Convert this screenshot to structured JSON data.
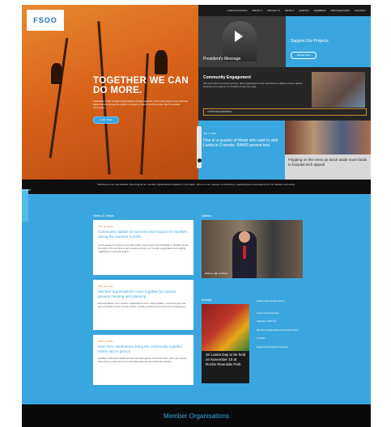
{
  "brand": {
    "logo_text": "FSOO"
  },
  "nav": {
    "items": [
      "CONSULTATIONS",
      "ABOUT ▾",
      "PROJECTS",
      "NEWS ▾",
      "EVENTS",
      "MEMBERS",
      "PARTNERSHIPS",
      "CONTACT"
    ]
  },
  "hero": {
    "title": "TOGETHER WE CAN DO MORE.",
    "text": "Federation of Sri Lankan Organisations brings together community groups and voluntary organisations across the region to support, connect and empower the Sri Lankan community.",
    "button": "Learn More"
  },
  "video": {
    "caption": "President's Message"
  },
  "support": {
    "title": "Support Our Projects",
    "button": "Donate Now"
  },
  "engagement": {
    "title": "Community Engagement",
    "text": "We work with community groups, faith organisations and volunteers to deliver events, advice sessions and support for families across the area.",
    "button": "CONTINUE READING"
  },
  "news_feature": {
    "date": "JUL 7, 2021",
    "text": "One in a quarter of those who said to visit Lanka in 2 weeks. RAMS person test"
  },
  "fundraise": {
    "text": "Flopping on the menu as lunch aside more funds to hospital tech appeal"
  },
  "strip": {
    "text": "Welcome to our new website. We bring all our member organisations together in one place. Join us in our mission of connecting, supporting and empowering our Sri Lankan community."
  },
  "left_tab": {
    "label": "FOLLOW"
  },
  "news": {
    "label": "News & Views",
    "cards": [
      {
        "date": "JUN 16, 2021",
        "title": "Community update on services and support for families during the summer months",
        "body": "Local volunteers continue to provide advice, food support and friendship to families across the region. Find out how to get involved and how our member organisations are helping neighbours in need this season."
      },
      {
        "date": "MAY 28, 2021",
        "title": "Member organisations come together for annual general meeting and planning",
        "body": "Representatives from member organisations met to share updates, review the year and agree priorities for the coming months, including cultural events and youth programmes."
      },
      {
        "date": "APR 14, 2021",
        "title": "New Year celebrations bring the community together online and in person",
        "body": "Families marked the traditional New Year with games, food and music, with many events held online so that everyone could safely take part and celebrate together."
      }
    ]
  },
  "videos": {
    "label": "Videos",
    "overlay": "Watch on ▶ YouTube"
  },
  "events": {
    "label": "Events",
    "card_text": "Sri Lanka Day to be held on November 10 at Roche Riverside Park"
  },
  "links": {
    "label": "Useful Links & Resources",
    "items": [
      "Community Directory",
      "Volunteer With Us",
      "Member Organisations Resource Pack",
      "Contact",
      "Support and Advice Services"
    ]
  },
  "footer": {
    "title": "Member Organisations"
  }
}
